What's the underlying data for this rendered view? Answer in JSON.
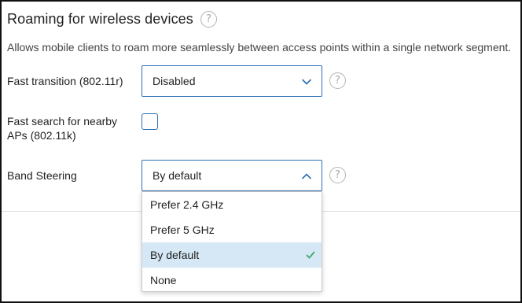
{
  "section": {
    "title": "Roaming for wireless devices",
    "help_icon": "?",
    "description": "Allows mobile clients to roam more seamlessly between access points within a single network segment."
  },
  "fast_transition": {
    "label": "Fast transition (802.11r)",
    "value": "Disabled",
    "help_icon": "?"
  },
  "fast_search": {
    "label_line1": "Fast search for nearby",
    "label_line2": "APs (802.11k)",
    "checked": false
  },
  "band_steering": {
    "label": "Band Steering",
    "value": "By default",
    "help_icon": "?",
    "options": [
      {
        "label": "Prefer 2.4 GHz",
        "selected": false
      },
      {
        "label": "Prefer 5 GHz",
        "selected": false
      },
      {
        "label": "By default",
        "selected": true
      },
      {
        "label": "None",
        "selected": false
      }
    ]
  },
  "colors": {
    "accent": "#2b6fb4",
    "selected_bg": "#d6e8f5",
    "check": "#3ea86b"
  }
}
